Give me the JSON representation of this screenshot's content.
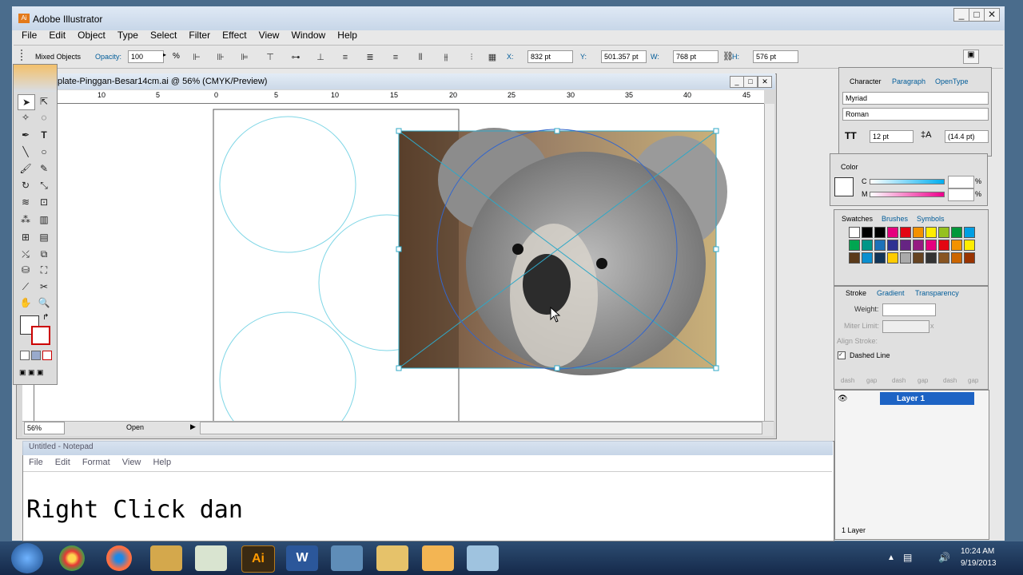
{
  "app": {
    "title": "Adobe Illustrator",
    "menu": [
      "File",
      "Edit",
      "Object",
      "Type",
      "Select",
      "Filter",
      "Effect",
      "View",
      "Window",
      "Help"
    ]
  },
  "control_bar": {
    "selection_label": "Mixed Objects",
    "opacity_label": "Opacity:",
    "opacity_value": "100",
    "opacity_unit": "%",
    "x_label": "X:",
    "x_value": "832 pt",
    "y_label": "Y:",
    "y_value": "501.357 pt",
    "w_label": "W:",
    "w_value": "768 pt",
    "h_label": "H:",
    "h_value": "576 pt"
  },
  "document": {
    "title": "plate-Pinggan-Besar14cm.ai @ 56% (CMYK/Preview)",
    "ruler_labels": [
      "10",
      "5",
      "0",
      "5",
      "10",
      "15",
      "20",
      "25",
      "30",
      "35",
      "40",
      "45"
    ],
    "zoom": "56%",
    "status": "Open"
  },
  "character_panel": {
    "tabs": [
      "Character",
      "Paragraph",
      "OpenType"
    ],
    "font_family": "Myriad",
    "font_style": "Roman",
    "font_size": "12 pt",
    "leading": "(14.4 pt)"
  },
  "color_panel": {
    "tab": "Color",
    "c_label": "C",
    "c_unit": "%",
    "m_label": "M",
    "m_unit": "%"
  },
  "swatches_panel": {
    "tabs": [
      "Swatches",
      "Brushes",
      "Symbols"
    ],
    "row1": [
      "#ffffff",
      "#000000",
      "#000000",
      "#e6007e",
      "#e30613",
      "#f39200",
      "#ffed00",
      "#95c11f",
      "#00983a",
      "#009fe3"
    ],
    "row2": [
      "#00a651",
      "#009688",
      "#1d71b8",
      "#2e3192",
      "#662483",
      "#951b81",
      "#e6007e",
      "#e30613",
      "#f39200",
      "#ffed00"
    ],
    "row3": [
      "#5a3a1a",
      "#0b8fcf",
      "#123456",
      "#ffcc00",
      "#aaaaaa",
      "#664422",
      "#333333",
      "#885522",
      "#cc6600",
      "#993300"
    ]
  },
  "stroke_panel": {
    "tabs": [
      "Stroke",
      "Gradient",
      "Transparency"
    ],
    "weight_label": "Weight:",
    "miter_label": "Miter Limit:",
    "miter_unit": "x",
    "align_label": "Align Stroke:",
    "dashed_label": "Dashed Line",
    "dash_labels": [
      "dash",
      "gap",
      "dash",
      "gap",
      "dash",
      "gap"
    ]
  },
  "layers_panel": {
    "layer_name": "Layer 1",
    "count": "1 Layer"
  },
  "notepad": {
    "title": "Untitled - Notepad",
    "menu": [
      "File",
      "Edit",
      "Format",
      "View",
      "Help"
    ],
    "content": "Right Click dan"
  },
  "taskbar": {
    "time": "10:24 AM",
    "date": "9/19/2013",
    "apps": [
      "chrome",
      "firefox",
      "media-player",
      "files",
      "illustrator",
      "word",
      "picture",
      "folder",
      "paint",
      "notepad"
    ]
  },
  "colors": {
    "selection_blue": "#00b3d6",
    "layer_highlight": "#1d63c4",
    "taskbar": "#1f3a5a"
  }
}
